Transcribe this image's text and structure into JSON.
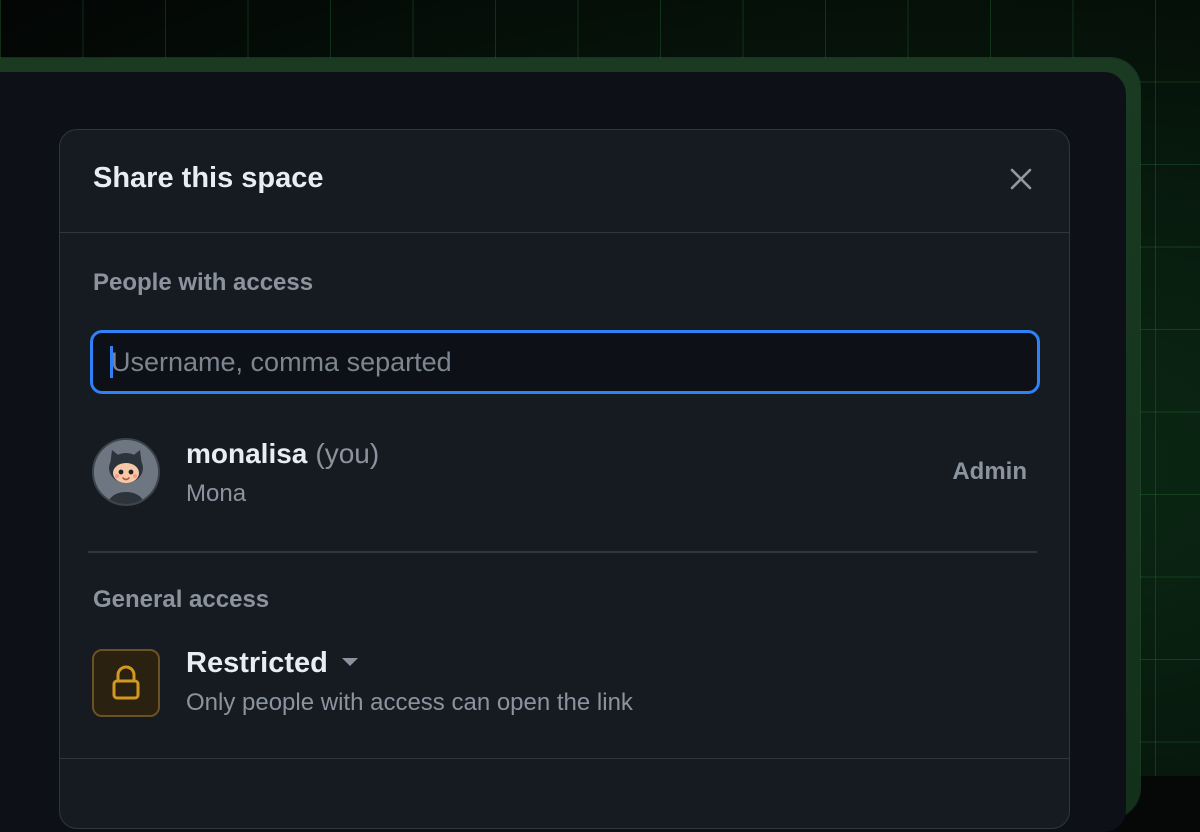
{
  "dialog": {
    "title": "Share this space",
    "close_icon": "close-icon"
  },
  "people": {
    "label": "People with access",
    "input_placeholder": "Username, comma separted",
    "input_value": ""
  },
  "users": [
    {
      "username": "monalisa",
      "you_tag": "(you)",
      "display_name": "Mona",
      "role": "Admin",
      "avatar_icon": "octocat-avatar-icon"
    }
  ],
  "general": {
    "label": "General access",
    "level": "Restricted",
    "description": "Only people with access can open the link",
    "icon": "lock-icon",
    "icon_color": "#d29922"
  },
  "colors": {
    "accent": "#2f81f7",
    "background": "#161b22"
  }
}
